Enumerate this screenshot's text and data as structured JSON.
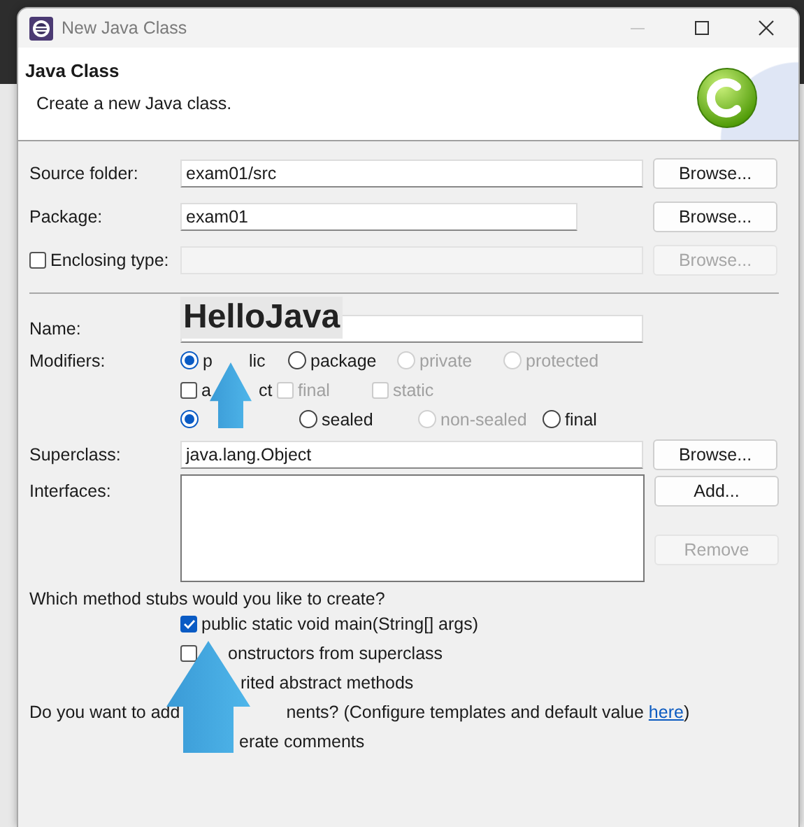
{
  "window": {
    "title": "New Java Class"
  },
  "header": {
    "title": "Java Class",
    "description": "Create a new Java class."
  },
  "fields": [
    {
      "kind": "text",
      "label": "Source folder:",
      "value": "exam01/src",
      "short": false,
      "button": {
        "label": "Browse...",
        "disabled": false
      }
    },
    {
      "kind": "text",
      "label": "Package:",
      "value": "exam01",
      "short": true,
      "button": {
        "label": "Browse...",
        "disabled": false
      }
    },
    {
      "kind": "check",
      "label": "Enclosing type:",
      "checked": false,
      "button": {
        "label": "Browse...",
        "disabled": true
      }
    }
  ],
  "name": {
    "label": "Name:",
    "annotation": "HelloJava"
  },
  "modifiers": {
    "label": "Modifiers:",
    "rows": [
      [
        {
          "kind": "radio",
          "parts": [
            "p",
            "lic"
          ],
          "selected": true,
          "disabled": false
        },
        {
          "kind": "radio",
          "parts": [
            "package"
          ],
          "selected": false,
          "disabled": false
        },
        {
          "kind": "radio",
          "parts": [
            "private"
          ],
          "selected": false,
          "disabled": true
        },
        {
          "kind": "radio",
          "parts": [
            "protected"
          ],
          "selected": false,
          "disabled": true
        }
      ],
      [
        {
          "kind": "check",
          "parts": [
            "a",
            "ct"
          ],
          "checked": false,
          "disabled": false
        },
        {
          "kind": "check",
          "parts": [
            "final"
          ],
          "checked": false,
          "disabled": true
        },
        {
          "kind": "check",
          "parts": [
            "static"
          ],
          "checked": false,
          "disabled": true
        }
      ],
      [
        {
          "kind": "radio",
          "selected": true,
          "disabled": false
        },
        {
          "kind": "radio",
          "parts": [
            "sealed"
          ],
          "selected": false,
          "disabled": false
        },
        {
          "kind": "radio",
          "parts": [
            "non-sealed"
          ],
          "selected": false,
          "disabled": true
        },
        {
          "kind": "radio",
          "parts": [
            "final"
          ],
          "selected": false,
          "disabled": false
        }
      ]
    ]
  },
  "superclass": {
    "label": "Superclass:",
    "value": "java.lang.Object",
    "button": {
      "label": "Browse...",
      "disabled": false
    }
  },
  "interfaces": {
    "label": "Interfaces:",
    "buttons": [
      {
        "label": "Add...",
        "disabled": false
      },
      {
        "label": "Remove",
        "disabled": true
      }
    ]
  },
  "stubs": {
    "question": "Which method stubs would you like to create?",
    "options": [
      {
        "kind": "check",
        "label": "public static void main(String[] args)",
        "checked": true
      },
      {
        "kind": "check",
        "label": "onstructors from superclass",
        "checked": false
      },
      {
        "kind": "covered",
        "label": "rited abstract methods"
      }
    ]
  },
  "comments": {
    "question_start": "Do you want to add",
    "question_end": "nents? (Configure templates and default value ",
    "link": "here",
    "question_close": ")",
    "option": {
      "label": "erate comments"
    }
  }
}
